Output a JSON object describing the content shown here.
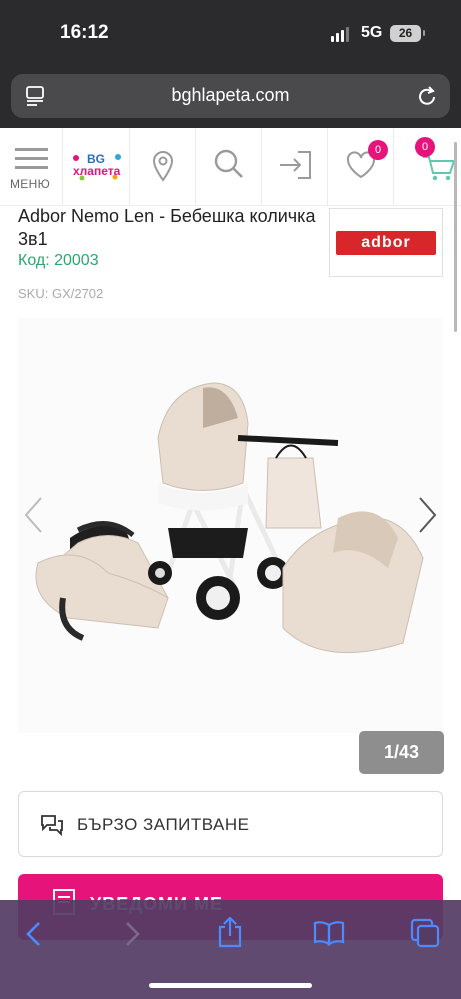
{
  "status": {
    "time": "16:12",
    "network": "5G",
    "battery": "26"
  },
  "browser": {
    "url": "bghlapeta.com"
  },
  "header": {
    "menu_label": "МЕНЮ",
    "logo_line1": "BG",
    "logo_line2": "хлапета",
    "wishlist_count": "0",
    "cart_count": "0"
  },
  "product": {
    "title": "Adbor Nemo Len - Бебешка количка 3в1",
    "code": "Код: 20003",
    "sku": "SKU: GX/2702",
    "brand": "adbor"
  },
  "gallery": {
    "counter": "1/43"
  },
  "actions": {
    "quick_inquiry": "БЪРЗО ЗАПИТВАНЕ",
    "primary_label": "УВЕДОМИ МЕ"
  },
  "colors": {
    "brand_pink": "#e5137a",
    "code_green": "#2aa870",
    "beige": "#e9dcd0"
  }
}
